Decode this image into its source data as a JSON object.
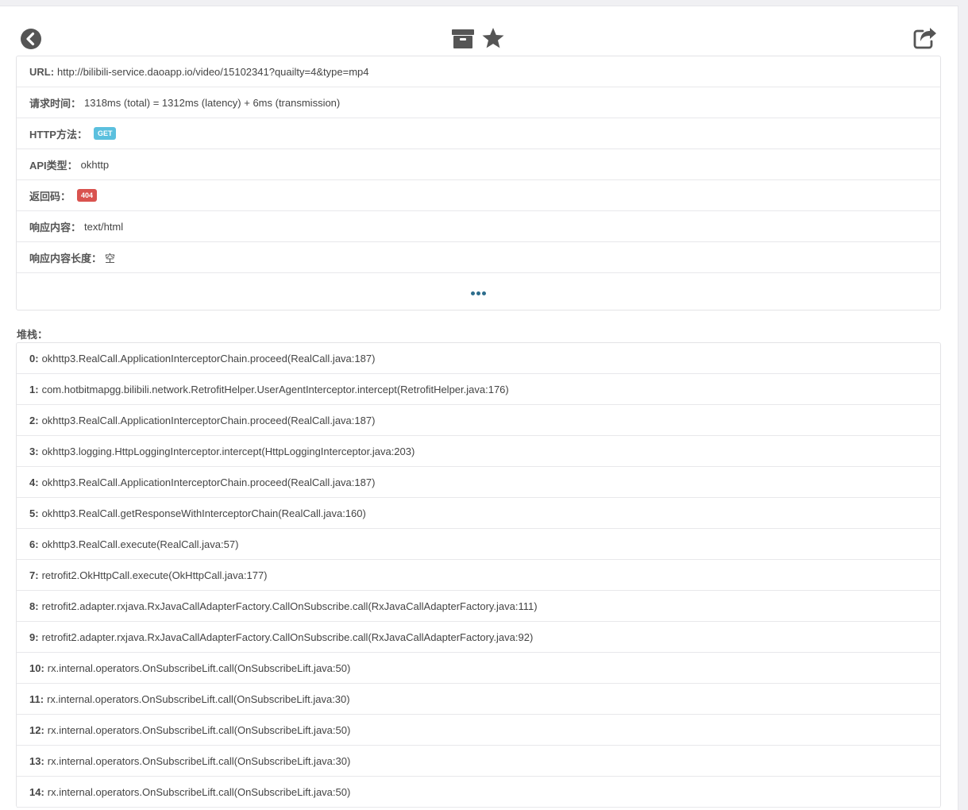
{
  "toolbar": {
    "back_icon": "circle-chevron-left-icon",
    "archive_icon": "archive-box-icon",
    "star_icon": "star-icon",
    "share_icon": "share-square-icon"
  },
  "request": {
    "url_label": "URL:",
    "url_value": "http://bilibili-service.daoapp.io/video/15102341?quailty=4&type=mp4",
    "time_label": "请求时间：",
    "time_value": "1318ms (total) = 1312ms (latency) + 6ms (transmission)",
    "method_label": "HTTP方法：",
    "method_value": "GET",
    "api_label": "API类型：",
    "api_value": "okhttp",
    "code_label": "返回码：",
    "code_value": "404",
    "content_type_label": "响应内容：",
    "content_type_value": "text/html",
    "content_length_label": "响应内容长度：",
    "content_length_value": "空",
    "more_icon": "ellipsis-icon"
  },
  "colors": {
    "get_badge": "#5bc0de",
    "error_badge": "#d9534f",
    "ellipsis": "#2d6d8c"
  },
  "stack": {
    "title": "堆栈：",
    "frames": [
      {
        "index": "0:",
        "text": "okhttp3.RealCall.ApplicationInterceptorChain.proceed(RealCall.java:187)"
      },
      {
        "index": "1:",
        "text": "com.hotbitmapgg.bilibili.network.RetrofitHelper.UserAgentInterceptor.intercept(RetrofitHelper.java:176)"
      },
      {
        "index": "2:",
        "text": "okhttp3.RealCall.ApplicationInterceptorChain.proceed(RealCall.java:187)"
      },
      {
        "index": "3:",
        "text": "okhttp3.logging.HttpLoggingInterceptor.intercept(HttpLoggingInterceptor.java:203)"
      },
      {
        "index": "4:",
        "text": "okhttp3.RealCall.ApplicationInterceptorChain.proceed(RealCall.java:187)"
      },
      {
        "index": "5:",
        "text": "okhttp3.RealCall.getResponseWithInterceptorChain(RealCall.java:160)"
      },
      {
        "index": "6:",
        "text": "okhttp3.RealCall.execute(RealCall.java:57)"
      },
      {
        "index": "7:",
        "text": "retrofit2.OkHttpCall.execute(OkHttpCall.java:177)"
      },
      {
        "index": "8:",
        "text": "retrofit2.adapter.rxjava.RxJavaCallAdapterFactory.CallOnSubscribe.call(RxJavaCallAdapterFactory.java:111)"
      },
      {
        "index": "9:",
        "text": "retrofit2.adapter.rxjava.RxJavaCallAdapterFactory.CallOnSubscribe.call(RxJavaCallAdapterFactory.java:92)"
      },
      {
        "index": "10:",
        "text": "rx.internal.operators.OnSubscribeLift.call(OnSubscribeLift.java:50)"
      },
      {
        "index": "11:",
        "text": "rx.internal.operators.OnSubscribeLift.call(OnSubscribeLift.java:30)"
      },
      {
        "index": "12:",
        "text": "rx.internal.operators.OnSubscribeLift.call(OnSubscribeLift.java:50)"
      },
      {
        "index": "13:",
        "text": "rx.internal.operators.OnSubscribeLift.call(OnSubscribeLift.java:30)"
      },
      {
        "index": "14:",
        "text": "rx.internal.operators.OnSubscribeLift.call(OnSubscribeLift.java:50)"
      }
    ]
  }
}
